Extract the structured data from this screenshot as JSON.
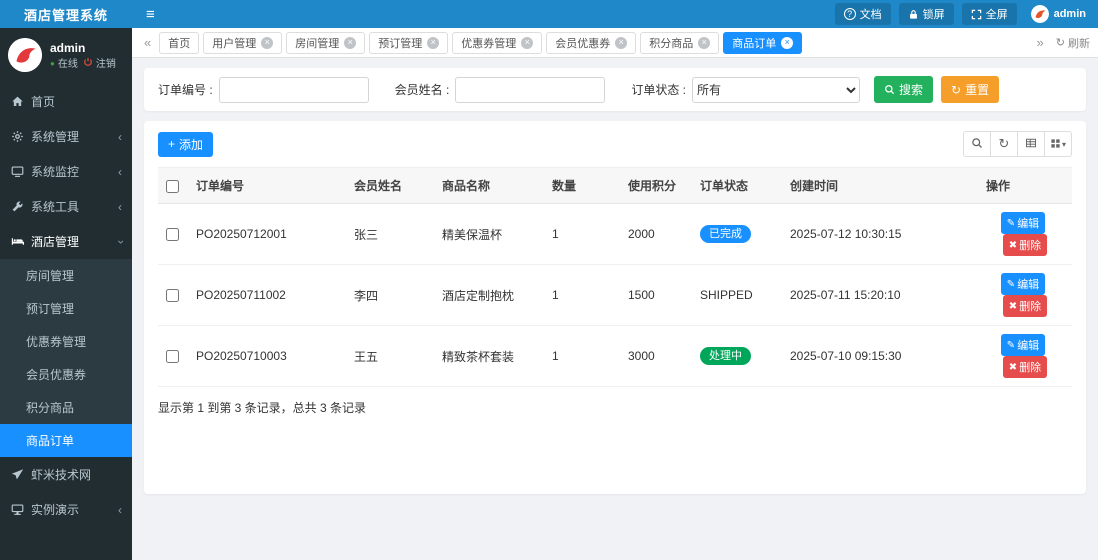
{
  "colors": {
    "topbar": "#1e88c8",
    "primary": "#1890ff",
    "sidebar": "#222d32",
    "success_badge": "#00a65a",
    "search_button": "#23b15e",
    "reset_button": "#f59e2a",
    "delete_button": "#e64c4c"
  },
  "icons": {
    "menu": "≡",
    "question": "?",
    "prev": "«",
    "next": "»",
    "refresh": "↻",
    "chevron_left": "‹",
    "close": "×",
    "plus": "+",
    "caret": "▾",
    "dot": "●",
    "pencil": "✎",
    "cross": "✖"
  },
  "topbar": {
    "brand": "酒店管理系统",
    "docs_label": "文档",
    "lock_label": "锁屏",
    "fullscreen_label": "全屏",
    "username": "admin"
  },
  "sidebar": {
    "user": {
      "name": "admin",
      "status_online": "在线",
      "logout": "注销"
    },
    "items": [
      {
        "label": "首页"
      },
      {
        "label": "系统管理"
      },
      {
        "label": "系统监控"
      },
      {
        "label": "系统工具"
      },
      {
        "label": "酒店管理"
      },
      {
        "label": "虾米技术网"
      },
      {
        "label": "实例演示"
      }
    ],
    "hotel_children": [
      {
        "label": "房间管理"
      },
      {
        "label": "预订管理"
      },
      {
        "label": "优惠券管理"
      },
      {
        "label": "会员优惠券"
      },
      {
        "label": "积分商品"
      },
      {
        "label": "商品订单"
      }
    ]
  },
  "tabbar": {
    "tabs": [
      {
        "label": "首页"
      },
      {
        "label": "用户管理"
      },
      {
        "label": "房间管理"
      },
      {
        "label": "预订管理"
      },
      {
        "label": "优惠券管理"
      },
      {
        "label": "会员优惠券"
      },
      {
        "label": "积分商品"
      },
      {
        "label": "商品订单"
      }
    ],
    "refresh_label": "刷新"
  },
  "filters": {
    "order_no_label": "订单编号 :",
    "member_name_label": "会员姓名 :",
    "status_label": "订单状态 :",
    "status_value": "所有",
    "search_label": "搜索",
    "reset_label": "重置"
  },
  "toolbar": {
    "add_label": "添加"
  },
  "table": {
    "headers": [
      "订单编号",
      "会员姓名",
      "商品名称",
      "数量",
      "使用积分",
      "订单状态",
      "创建时间",
      "操作"
    ],
    "rows": [
      {
        "order_no": "PO20250712001",
        "member": "张三",
        "product": "精美保温杯",
        "qty": "1",
        "points": "2000",
        "status": "已完成",
        "created": "2025-07-12 10:30:15"
      },
      {
        "order_no": "PO20250711002",
        "member": "李四",
        "product": "酒店定制抱枕",
        "qty": "1",
        "points": "1500",
        "status": "SHIPPED",
        "created": "2025-07-11 15:20:10"
      },
      {
        "order_no": "PO20250710003",
        "member": "王五",
        "product": "精致茶杯套装",
        "qty": "1",
        "points": "3000",
        "status": "处理中",
        "created": "2025-07-10 09:15:30"
      }
    ],
    "edit_label": "编辑",
    "delete_label": "删除",
    "summary": "显示第 1 到第 3 条记录，总共 3 条记录"
  }
}
